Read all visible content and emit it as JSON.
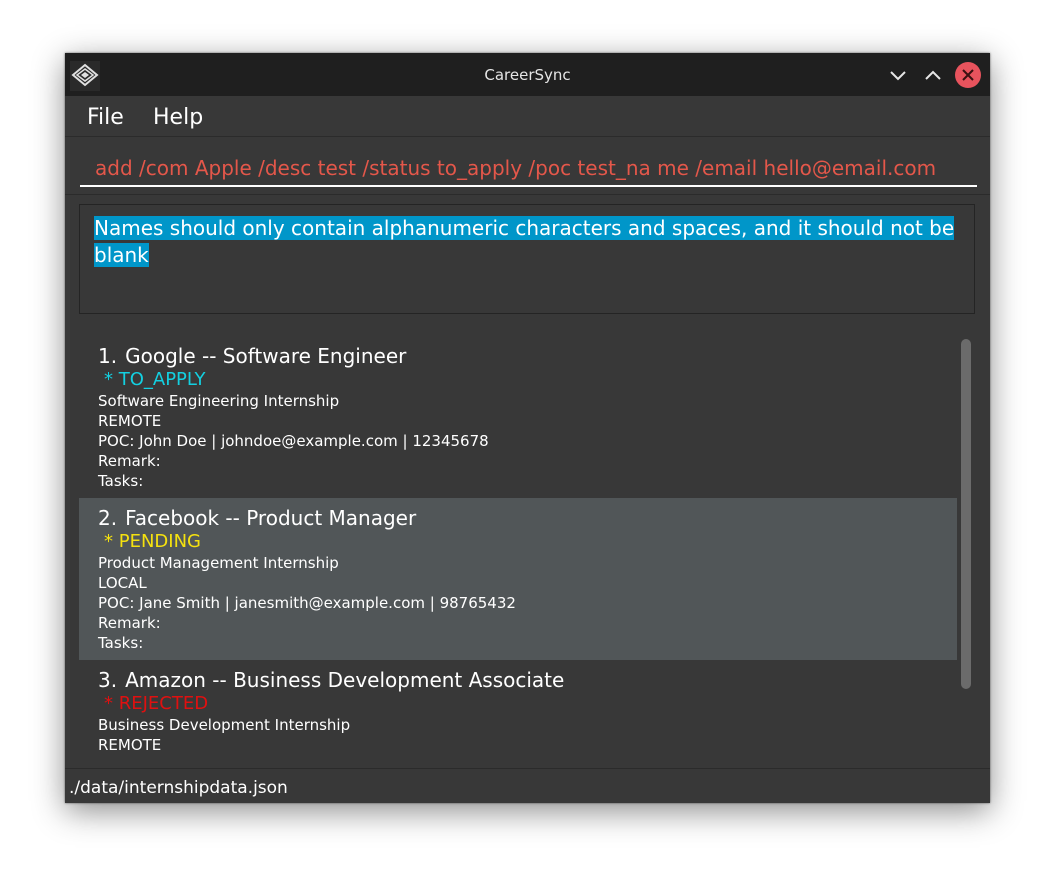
{
  "window": {
    "title": "CareerSync",
    "icon": "app-diamond-icon",
    "controls": [
      "minimize-icon",
      "maximize-icon",
      "close-icon"
    ]
  },
  "menu": {
    "file": "File",
    "help": "Help"
  },
  "command": {
    "value": "add /com Apple /desc test /status to_apply /poc test_na me /email hello@email.com"
  },
  "result": {
    "message": "Names should only contain alphanumeric characters and spaces, and it should not be blank"
  },
  "internships": [
    {
      "index": "1.",
      "title": "Google -- Software Engineer",
      "status": "* TO_APPLY",
      "description": "Software Engineering Internship",
      "location": "REMOTE",
      "poc": "POC: John Doe | johndoe@example.com | 12345678",
      "remark": "Remark:",
      "tasks": "Tasks:"
    },
    {
      "index": "2.",
      "title": "Facebook -- Product Manager",
      "status": "* PENDING",
      "description": "Product Management Internship",
      "location": "LOCAL",
      "poc": "POC: Jane Smith | janesmith@example.com | 98765432",
      "remark": "Remark:",
      "tasks": "Tasks:"
    },
    {
      "index": "3.",
      "title": "Amazon -- Business Development Associate",
      "status": "* REJECTED",
      "description": "Business Development Internship",
      "location": "REMOTE"
    }
  ],
  "status_colors": {
    "to_apply": "#13d0e1",
    "pending": "#f5e10f",
    "rejected": "#e01010"
  },
  "statusbar": {
    "path": "./data/internshipdata.json"
  }
}
